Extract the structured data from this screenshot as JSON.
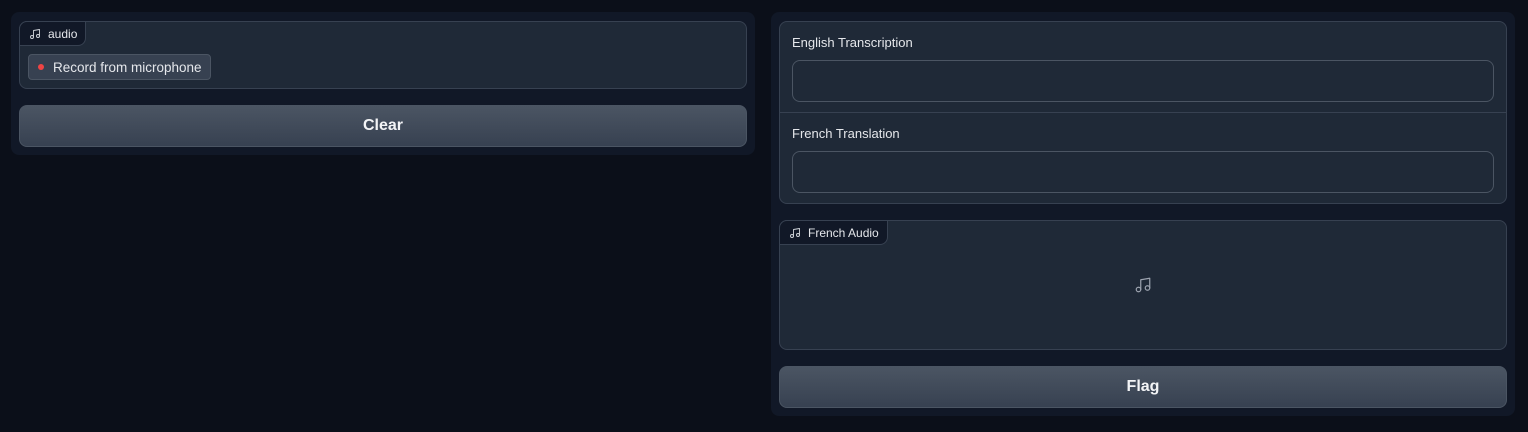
{
  "left": {
    "audio_input": {
      "label": "audio",
      "record_label": "Record from microphone"
    },
    "clear_label": "Clear"
  },
  "right": {
    "english": {
      "label": "English Transcription",
      "value": ""
    },
    "french": {
      "label": "French Translation",
      "value": ""
    },
    "french_audio": {
      "label": "French Audio"
    },
    "flag_label": "Flag"
  },
  "colors": {
    "background": "#0b0f19",
    "panel": "#111827",
    "block": "#1f2937",
    "border": "#374151",
    "record_dot": "#ef4444"
  },
  "icons": {
    "audio_tag": "music-note-icon",
    "record": "record-dot-icon",
    "empty_audio": "music-note-icon"
  }
}
